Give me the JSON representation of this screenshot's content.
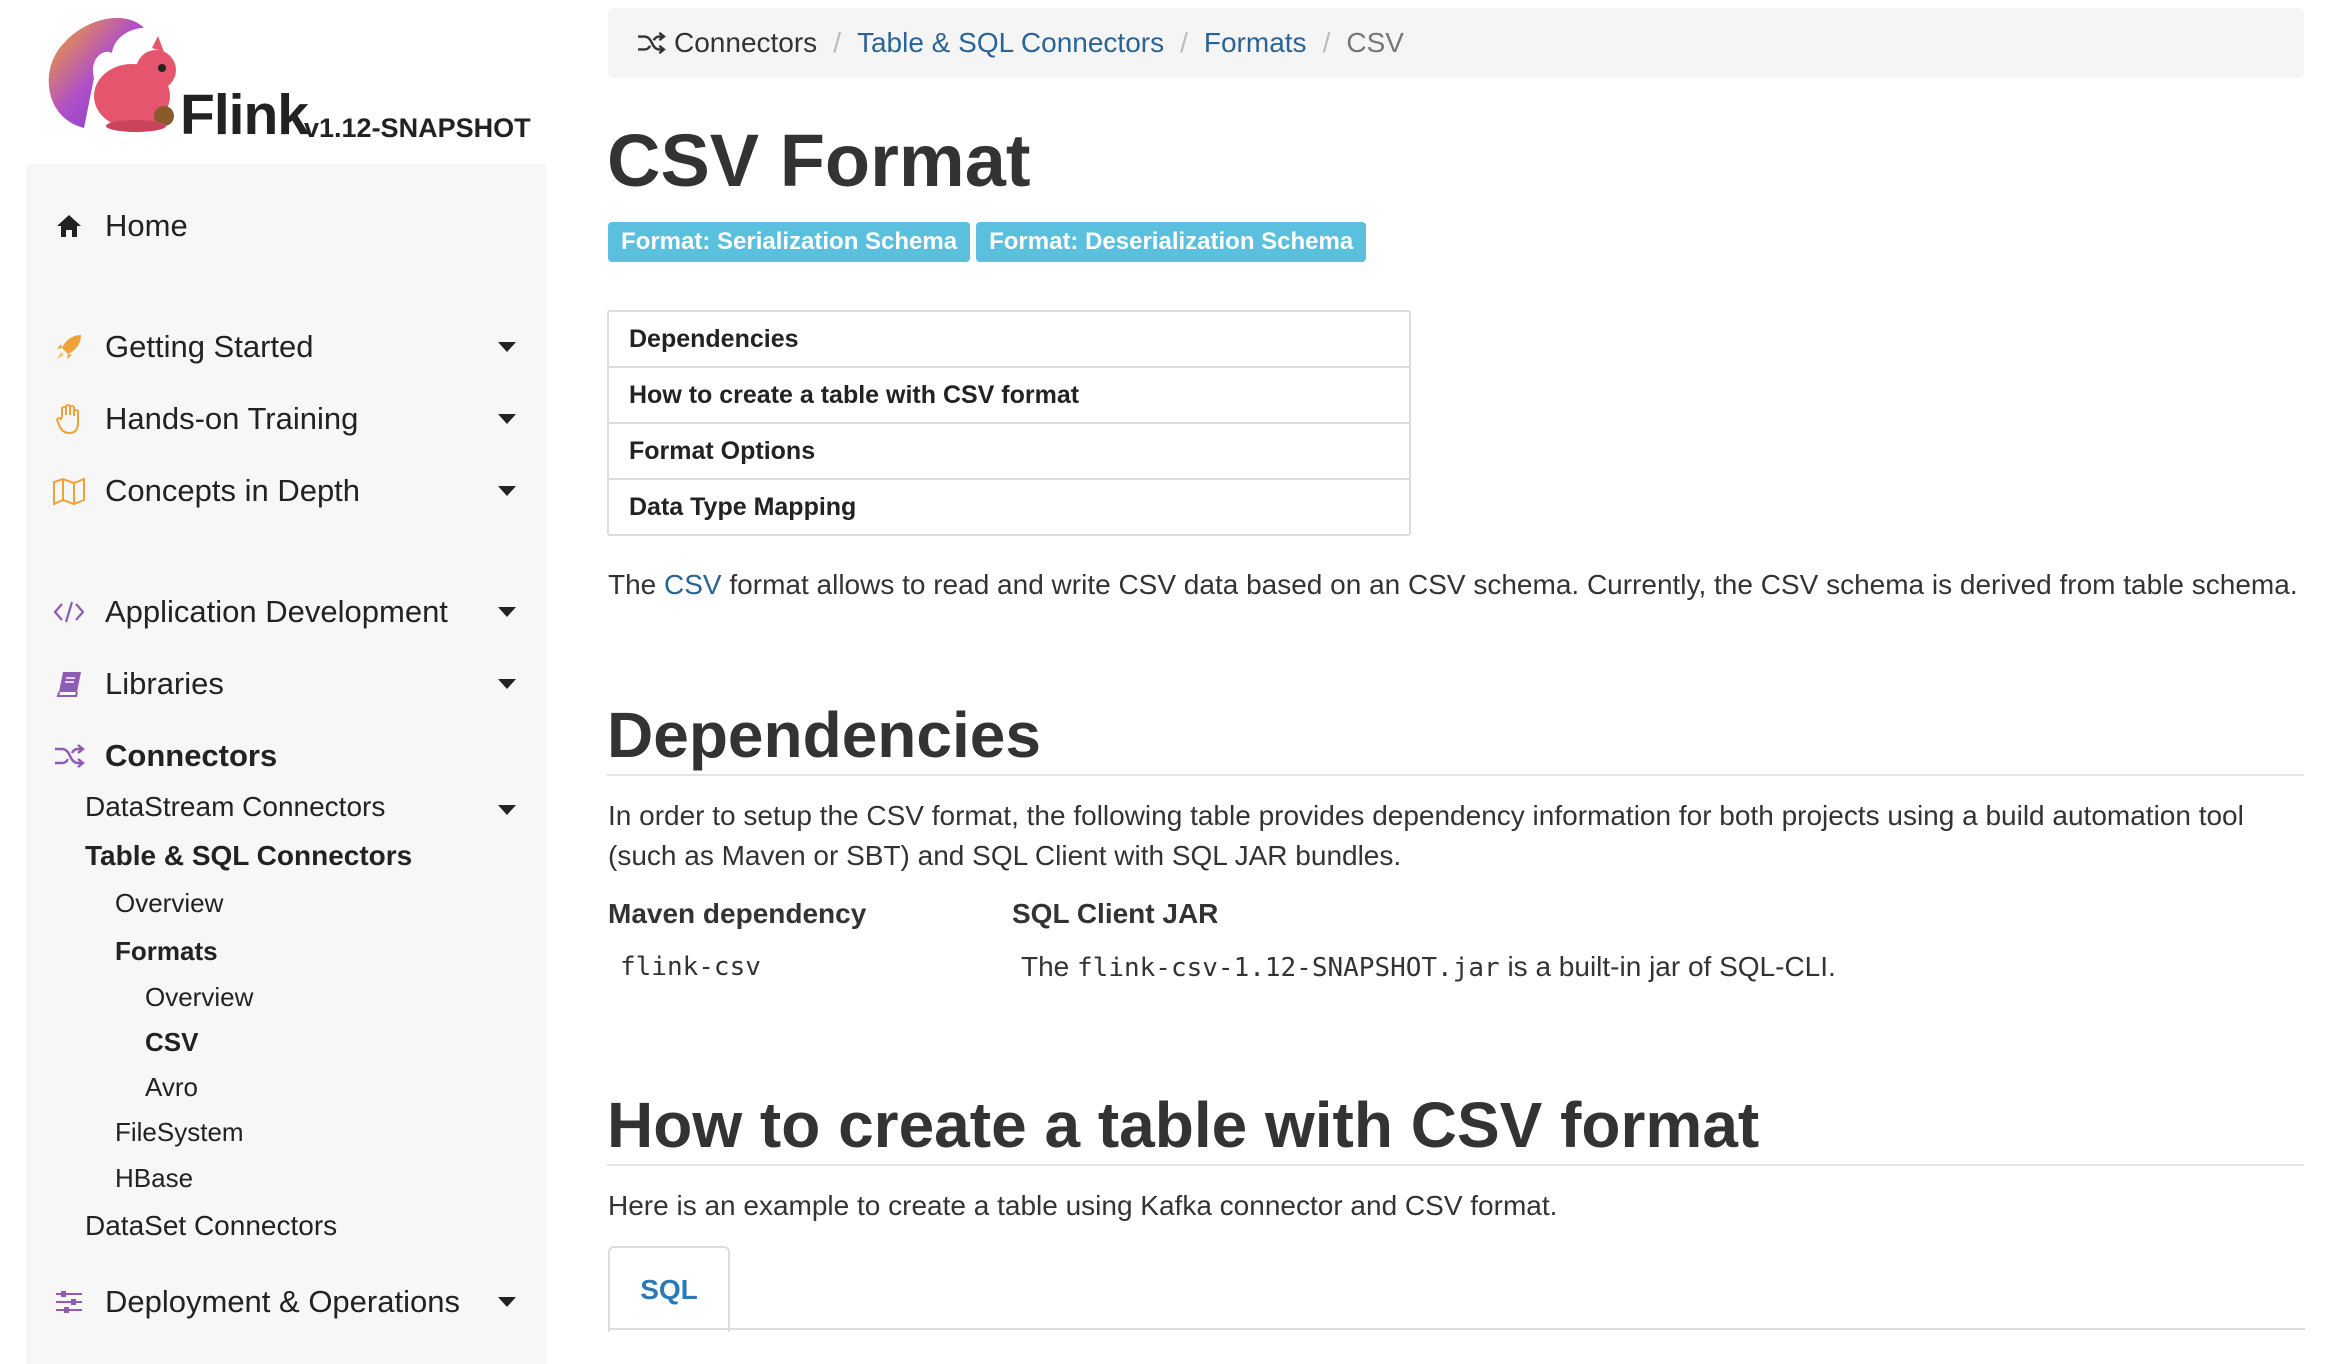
{
  "logo": {
    "name": "Flink",
    "version": "v1.12-SNAPSHOT"
  },
  "sidebar": {
    "items": [
      {
        "label": "Home",
        "icon": "home-icon"
      },
      {
        "label": "Getting Started",
        "icon": "rocket-icon"
      },
      {
        "label": "Hands-on Training",
        "icon": "hand-icon"
      },
      {
        "label": "Concepts in Depth",
        "icon": "map-icon"
      },
      {
        "label": "Application Development",
        "icon": "code-icon"
      },
      {
        "label": "Libraries",
        "icon": "book-icon"
      },
      {
        "label": "Connectors",
        "icon": "random-icon"
      },
      {
        "label": "Deployment & Operations",
        "icon": "sliders-icon"
      }
    ],
    "connectors": {
      "datastream": "DataStream Connectors",
      "table_sql": "Table & SQL Connectors",
      "overview": "Overview",
      "formats": "Formats",
      "formats_overview": "Overview",
      "csv": "CSV",
      "avro": "Avro",
      "filesystem": "FileSystem",
      "hbase": "HBase",
      "dataset": "DataSet Connectors"
    }
  },
  "breadcrumb": {
    "root": "Connectors",
    "items": [
      "Table & SQL Connectors",
      "Formats"
    ],
    "current": "CSV",
    "separator": "/"
  },
  "page": {
    "title": "CSV Format",
    "badges": [
      "Format: Serialization Schema",
      "Format: Deserialization Schema"
    ],
    "toc": [
      "Dependencies",
      "How to create a table with CSV format",
      "Format Options",
      "Data Type Mapping"
    ],
    "intro": {
      "prefix": "The ",
      "link": "CSV",
      "suffix": " format allows to read and write CSV data based on an CSV schema. Currently, the CSV schema is derived from table schema."
    },
    "dependencies": {
      "heading": "Dependencies",
      "text": "In order to setup the CSV format, the following table provides dependency information for both projects using a build automation tool (such as Maven or SBT) and SQL Client with SQL JAR bundles.",
      "col_maven": "Maven dependency",
      "col_sql": "SQL Client JAR",
      "maven_value": "flink-csv",
      "sql_prefix": "The ",
      "sql_jar": "flink-csv-1.12-SNAPSHOT.jar",
      "sql_suffix": " is a built-in jar of SQL-CLI."
    },
    "create": {
      "heading": "How to create a table with CSV format",
      "text": "Here is an example to create a table using Kafka connector and CSV format.",
      "tab": "SQL"
    }
  },
  "colors": {
    "badge": "#5bc0de",
    "link": "#2a6496",
    "sidebar_bg": "#f7f7f7"
  }
}
